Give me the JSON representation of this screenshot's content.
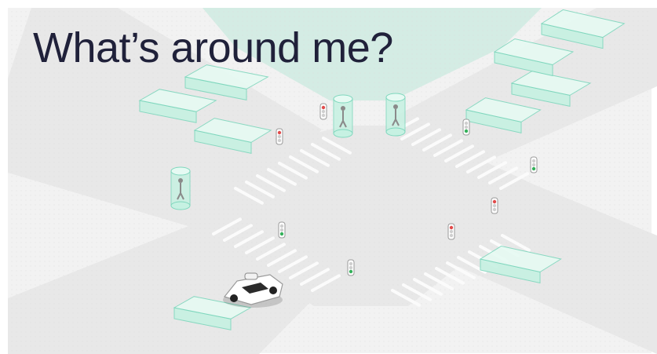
{
  "title": "What’s around me?",
  "colors": {
    "title_text": "#20213a",
    "road": "#e8e8e8",
    "sidewalk": "#f2f2f2",
    "park": "#d4ece4",
    "crosswalk": "#fbfbfb",
    "lane_line": "#ffffff",
    "box_fill": "#c6f1e2",
    "box_top": "#e6faf3",
    "box_edge": "#7fd7bd",
    "light_red": "#e14b4b",
    "light_green": "#34b05a",
    "car_body": "#ffffff"
  },
  "scene": {
    "detected_objects": [
      {
        "kind": "vehicle",
        "icon": "vehicle-bounding-box"
      },
      {
        "kind": "vehicle",
        "icon": "vehicle-bounding-box"
      },
      {
        "kind": "vehicle",
        "icon": "vehicle-bounding-box"
      },
      {
        "kind": "vehicle",
        "icon": "vehicle-bounding-box"
      },
      {
        "kind": "vehicle",
        "icon": "vehicle-bounding-box"
      },
      {
        "kind": "vehicle",
        "icon": "vehicle-bounding-box"
      },
      {
        "kind": "vehicle",
        "icon": "vehicle-bounding-box"
      },
      {
        "kind": "vehicle",
        "icon": "vehicle-bounding-box"
      },
      {
        "kind": "vehicle",
        "icon": "vehicle-bounding-box"
      },
      {
        "kind": "pedestrian",
        "icon": "pedestrian-bounding-cylinder"
      },
      {
        "kind": "pedestrian",
        "icon": "pedestrian-bounding-cylinder"
      },
      {
        "kind": "pedestrian",
        "icon": "pedestrian-bounding-cylinder"
      }
    ],
    "traffic_lights": [
      {
        "state": "red"
      },
      {
        "state": "red"
      },
      {
        "state": "green"
      },
      {
        "state": "green"
      },
      {
        "state": "red"
      },
      {
        "state": "green"
      },
      {
        "state": "red"
      },
      {
        "state": "green"
      }
    ],
    "ego_vehicle": {
      "kind": "self-driving car",
      "icon": "autonomous-car-icon"
    }
  }
}
